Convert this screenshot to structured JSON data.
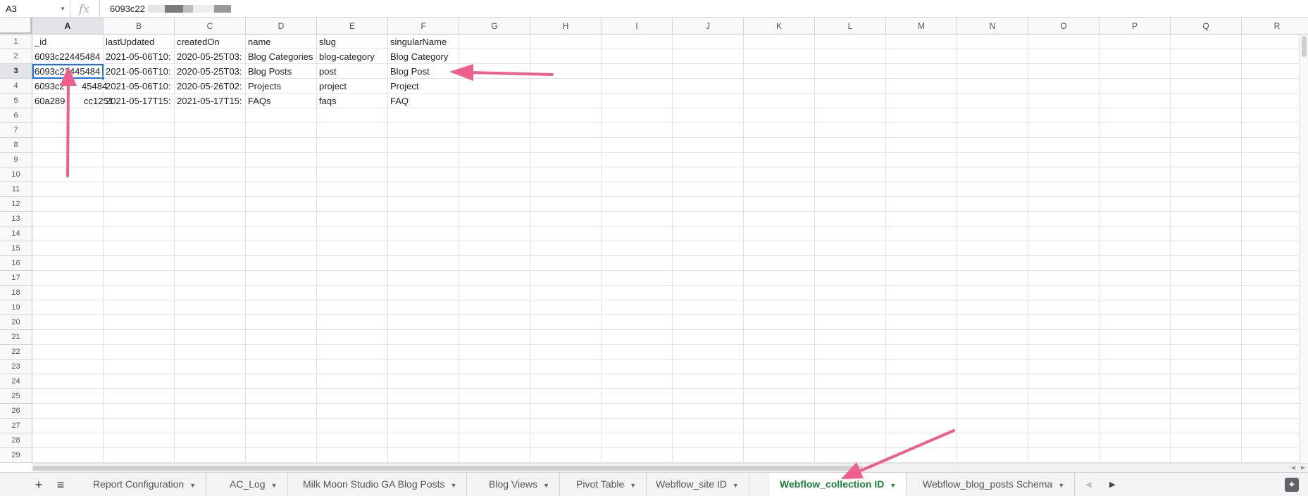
{
  "formula_bar": {
    "cell_ref": "A3",
    "fx_label": "fx",
    "value_visible": "6093c22"
  },
  "columns": [
    "A",
    "B",
    "C",
    "D",
    "E",
    "F",
    "G",
    "H",
    "I",
    "J",
    "K",
    "L",
    "M",
    "N",
    "O",
    "P",
    "Q",
    "R"
  ],
  "rows": [
    "1",
    "2",
    "3",
    "4",
    "5",
    "6",
    "7",
    "8",
    "9",
    "10",
    "11",
    "12",
    "13",
    "14",
    "15",
    "16",
    "17",
    "18",
    "19",
    "20",
    "21",
    "22",
    "23",
    "24",
    "25",
    "26",
    "27",
    "28",
    "29"
  ],
  "table": {
    "headers": [
      "_id",
      "lastUpdated",
      "createdOn",
      "name",
      "slug",
      "singularName"
    ],
    "rows": [
      [
        "6093c22445484",
        "2021-05-06T10:",
        "2020-05-25T03:",
        "Blog Categories",
        "blog-category",
        "Blog Category"
      ],
      [
        "6093c22445484",
        "2021-05-06T10:",
        "2020-05-25T03:",
        "Blog Posts",
        "post",
        "Blog Post"
      ],
      [
        "6093c2",
        "2021-05-06T10:",
        "2020-05-26T02:",
        "Projects",
        "project",
        "Project"
      ],
      [
        "60a289",
        "2021-05-17T15:",
        "2021-05-17T15:",
        "FAQs",
        "faqs",
        "FAQ"
      ]
    ],
    "partial_tails": {
      "r3": "45484",
      "r4": "cc1251"
    }
  },
  "selected_cell": "A3",
  "sheet_tabs": [
    {
      "label": "Report Configuration",
      "active": false
    },
    {
      "label": "AC_Log",
      "active": false
    },
    {
      "label": "Milk Moon Studio GA Blog Posts",
      "active": false
    },
    {
      "label": "Blog Views",
      "active": false
    },
    {
      "label": "Pivot Table",
      "active": false
    },
    {
      "label": "Webflow_site ID",
      "active": false
    },
    {
      "label": "Webflow_collection ID",
      "active": true
    },
    {
      "label": "Webflow_blog_posts Schema",
      "active": false
    }
  ],
  "tab_bar": {
    "add_icon": "+",
    "menu_icon": "≡",
    "nav_left_icon": "◀",
    "nav_right_icon": "▶",
    "explore_icon": "✦"
  },
  "colors": {
    "accent_selection": "#1a73e8",
    "active_tab_text": "#188038",
    "annotation_arrow": "#ee5f8a"
  },
  "icons": [
    "dropdown-caret-icon",
    "fx-icon",
    "add-sheet-icon",
    "all-sheets-icon",
    "tab-scroll-left-icon",
    "tab-scroll-right-icon",
    "explore-icon"
  ]
}
